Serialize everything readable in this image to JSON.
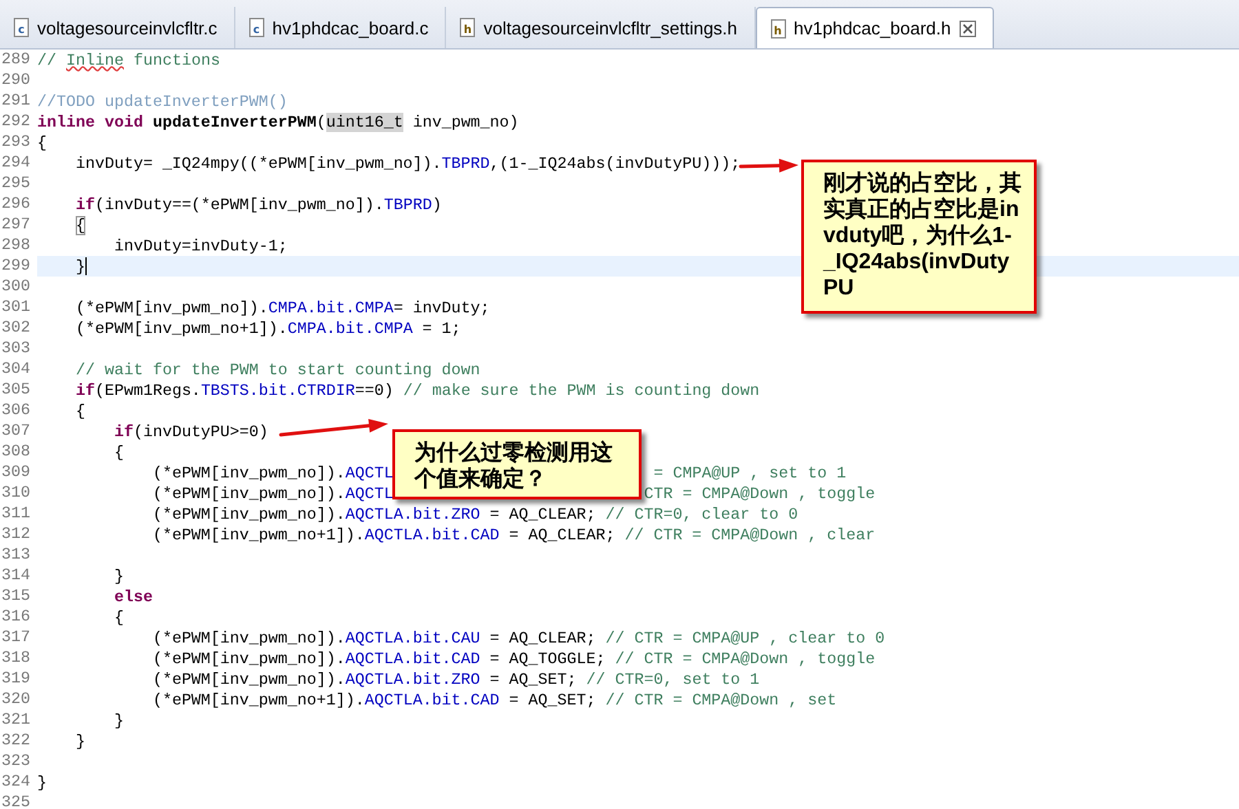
{
  "tabs": [
    {
      "file_type": "c",
      "label": "voltagesourceinvlcfltr.c",
      "selected": false,
      "closable": false
    },
    {
      "file_type": "c",
      "label": "hv1phdcac_board.c",
      "selected": false,
      "closable": false
    },
    {
      "file_type": "h",
      "label": "voltagesourceinvlcfltr_settings.h",
      "selected": false,
      "closable": false
    },
    {
      "file_type": "h",
      "label": "hv1phdcac_board.h",
      "selected": true,
      "closable": true
    }
  ],
  "lines": [
    {
      "number": "289",
      "current": false,
      "tokens": [
        {
          "kind": "comment",
          "text": "// "
        },
        {
          "kind": "misspelled",
          "text": "Inline"
        },
        {
          "kind": "comment",
          "text": " functions"
        }
      ]
    },
    {
      "number": "290",
      "current": false
    },
    {
      "number": "291",
      "current": false,
      "tokens": [
        {
          "kind": "todo",
          "text": "//TODO updateInverterPWM()"
        }
      ]
    },
    {
      "number": "292",
      "current": false,
      "tokens": [
        {
          "kind": "keyword",
          "text": "inline void"
        },
        {
          "kind": "declaration",
          "text": " updateInverterPWM"
        },
        {
          "kind": "plain",
          "text": "("
        },
        {
          "kind": "occurrence",
          "text": "uint16_t"
        },
        {
          "kind": "plain",
          "text": " inv_pwm_no)"
        }
      ]
    },
    {
      "number": "293",
      "current": false,
      "tokens": [
        {
          "kind": "plain",
          "text": "{"
        }
      ]
    },
    {
      "number": "294",
      "current": false,
      "tokens": [
        {
          "kind": "plain",
          "text": "    invDuty= _IQ24mpy((*ePWM[inv_pwm_no])."
        },
        {
          "kind": "field",
          "text": "TBPRD"
        },
        {
          "kind": "plain",
          "text": ",(1-_IQ24abs(invDutyPU)));"
        }
      ]
    },
    {
      "number": "295",
      "current": false
    },
    {
      "number": "296",
      "current": false,
      "tokens": [
        {
          "kind": "keyword",
          "text": "    if"
        },
        {
          "kind": "plain",
          "text": "(invDuty==(*ePWM[inv_pwm_no])."
        },
        {
          "kind": "field",
          "text": "TBPRD"
        },
        {
          "kind": "plain",
          "text": ")"
        }
      ]
    },
    {
      "number": "297",
      "current": false,
      "tokens": [
        {
          "kind": "bracket",
          "text": "    {"
        }
      ]
    },
    {
      "number": "298",
      "current": false,
      "tokens": [
        {
          "kind": "plain",
          "text": "        invDuty=invDuty-1;"
        }
      ]
    },
    {
      "number": "299",
      "current": true,
      "tokens": [
        {
          "kind": "plain",
          "text": "    }"
        }
      ]
    },
    {
      "number": "300",
      "current": false
    },
    {
      "number": "301",
      "current": false,
      "tokens": [
        {
          "kind": "plain",
          "text": "    (*ePWM[inv_pwm_no])."
        },
        {
          "kind": "field",
          "text": "CMPA.bit.CMPA"
        },
        {
          "kind": "plain",
          "text": "= invDuty;"
        }
      ]
    },
    {
      "number": "302",
      "current": false,
      "tokens": [
        {
          "kind": "plain",
          "text": "    (*ePWM[inv_pwm_no+1])."
        },
        {
          "kind": "field",
          "text": "CMPA.bit.CMPA"
        },
        {
          "kind": "plain",
          "text": " = 1;"
        }
      ]
    },
    {
      "number": "303",
      "current": false
    },
    {
      "number": "304",
      "current": false,
      "tokens": [
        {
          "kind": "comment",
          "text": "    // wait for the PWM to start counting down"
        }
      ]
    },
    {
      "number": "305",
      "current": false,
      "tokens": [
        {
          "kind": "keyword",
          "text": "    if"
        },
        {
          "kind": "plain",
          "text": "(EPwm1Regs."
        },
        {
          "kind": "field",
          "text": "TBSTS.bit.CTRDIR"
        },
        {
          "kind": "plain",
          "text": "==0) "
        },
        {
          "kind": "comment",
          "text": "// make sure the PWM is counting down"
        }
      ]
    },
    {
      "number": "306",
      "current": false,
      "tokens": [
        {
          "kind": "plain",
          "text": "    {"
        }
      ]
    },
    {
      "number": "307",
      "current": false,
      "tokens": [
        {
          "kind": "keyword",
          "text": "        if"
        },
        {
          "kind": "plain",
          "text": "(invDutyPU>=0)"
        }
      ]
    },
    {
      "number": "308",
      "current": false,
      "tokens": [
        {
          "kind": "plain",
          "text": "        {"
        }
      ]
    },
    {
      "number": "309",
      "current": false,
      "tokens": [
        {
          "kind": "plain",
          "text": "            (*ePWM[inv_pwm_no])."
        },
        {
          "kind": "field",
          "text": "AQCTL"
        },
        {
          "kind": "comment",
          "text": "                           = CMPA@UP , set to 1"
        }
      ]
    },
    {
      "number": "310",
      "current": false,
      "tokens": [
        {
          "kind": "plain",
          "text": "            (*ePWM[inv_pwm_no])."
        },
        {
          "kind": "field",
          "text": "AQCTL"
        },
        {
          "kind": "comment",
          "text": "                          CTR = CMPA@Down , toggle"
        }
      ]
    },
    {
      "number": "311",
      "current": false,
      "tokens": [
        {
          "kind": "plain",
          "text": "            (*ePWM[inv_pwm_no])."
        },
        {
          "kind": "field",
          "text": "AQCTLA.bit.ZRO"
        },
        {
          "kind": "plain",
          "text": " = AQ_CLEAR; "
        },
        {
          "kind": "comment",
          "text": "// CTR=0, clear to 0"
        }
      ]
    },
    {
      "number": "312",
      "current": false,
      "tokens": [
        {
          "kind": "plain",
          "text": "            (*ePWM[inv_pwm_no+1])."
        },
        {
          "kind": "field",
          "text": "AQCTLA.bit.CAD"
        },
        {
          "kind": "plain",
          "text": " = AQ_CLEAR; "
        },
        {
          "kind": "comment",
          "text": "// CTR = CMPA@Down , clear"
        }
      ]
    },
    {
      "number": "313",
      "current": false
    },
    {
      "number": "314",
      "current": false,
      "tokens": [
        {
          "kind": "plain",
          "text": "        }"
        }
      ]
    },
    {
      "number": "315",
      "current": false,
      "tokens": [
        {
          "kind": "keyword",
          "text": "        else"
        }
      ]
    },
    {
      "number": "316",
      "current": false,
      "tokens": [
        {
          "kind": "plain",
          "text": "        {"
        }
      ]
    },
    {
      "number": "317",
      "current": false,
      "tokens": [
        {
          "kind": "plain",
          "text": "            (*ePWM[inv_pwm_no])."
        },
        {
          "kind": "field",
          "text": "AQCTLA.bit.CAU"
        },
        {
          "kind": "plain",
          "text": " = AQ_CLEAR; "
        },
        {
          "kind": "comment",
          "text": "// CTR = CMPA@UP , clear to 0"
        }
      ]
    },
    {
      "number": "318",
      "current": false,
      "tokens": [
        {
          "kind": "plain",
          "text": "            (*ePWM[inv_pwm_no])."
        },
        {
          "kind": "field",
          "text": "AQCTLA.bit.CAD"
        },
        {
          "kind": "plain",
          "text": " = AQ_TOGGLE; "
        },
        {
          "kind": "comment",
          "text": "// CTR = CMPA@Down , toggle"
        }
      ]
    },
    {
      "number": "319",
      "current": false,
      "tokens": [
        {
          "kind": "plain",
          "text": "            (*ePWM[inv_pwm_no])."
        },
        {
          "kind": "field",
          "text": "AQCTLA.bit.ZRO"
        },
        {
          "kind": "plain",
          "text": " = AQ_SET; "
        },
        {
          "kind": "comment",
          "text": "// CTR=0, set to 1"
        }
      ]
    },
    {
      "number": "320",
      "current": false,
      "tokens": [
        {
          "kind": "plain",
          "text": "            (*ePWM[inv_pwm_no+1])."
        },
        {
          "kind": "field",
          "text": "AQCTLA.bit.CAD"
        },
        {
          "kind": "plain",
          "text": " = AQ_SET; "
        },
        {
          "kind": "comment",
          "text": "// CTR = CMPA@Down , set"
        }
      ]
    },
    {
      "number": "321",
      "current": false,
      "tokens": [
        {
          "kind": "plain",
          "text": "        }"
        }
      ]
    },
    {
      "number": "322",
      "current": false,
      "tokens": [
        {
          "kind": "plain",
          "text": "    }"
        }
      ]
    },
    {
      "number": "323",
      "current": false
    },
    {
      "number": "324",
      "current": false,
      "tokens": [
        {
          "kind": "plain",
          "text": "}"
        }
      ]
    },
    {
      "number": "325",
      "current": false
    }
  ],
  "callouts": [
    {
      "text": "刚才说的占空比，其实真正的占空比是invduty吧，为什么1-_IQ24abs(invDutyPU"
    },
    {
      "text": "为什么过零检测用这个值来确定？"
    }
  ]
}
